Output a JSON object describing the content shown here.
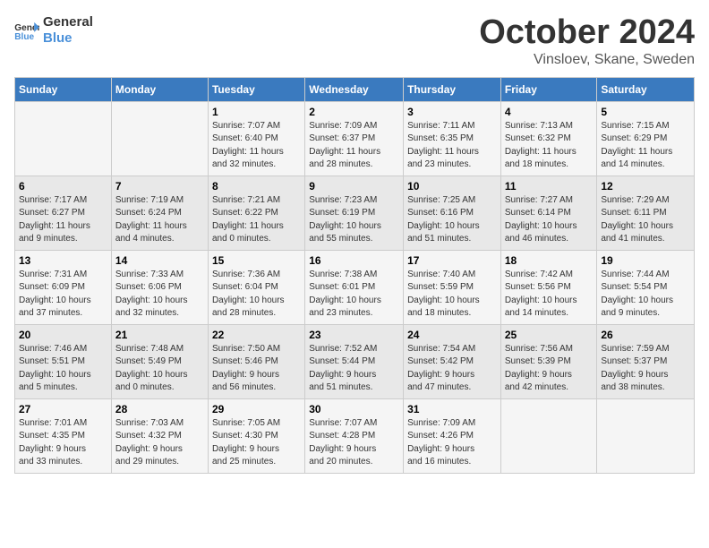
{
  "header": {
    "logo_general": "General",
    "logo_blue": "Blue",
    "month_title": "October 2024",
    "location": "Vinsloev, Skane, Sweden"
  },
  "days_of_week": [
    "Sunday",
    "Monday",
    "Tuesday",
    "Wednesday",
    "Thursday",
    "Friday",
    "Saturday"
  ],
  "weeks": [
    [
      {
        "day": "",
        "info": ""
      },
      {
        "day": "",
        "info": ""
      },
      {
        "day": "1",
        "info": "Sunrise: 7:07 AM\nSunset: 6:40 PM\nDaylight: 11 hours\nand 32 minutes."
      },
      {
        "day": "2",
        "info": "Sunrise: 7:09 AM\nSunset: 6:37 PM\nDaylight: 11 hours\nand 28 minutes."
      },
      {
        "day": "3",
        "info": "Sunrise: 7:11 AM\nSunset: 6:35 PM\nDaylight: 11 hours\nand 23 minutes."
      },
      {
        "day": "4",
        "info": "Sunrise: 7:13 AM\nSunset: 6:32 PM\nDaylight: 11 hours\nand 18 minutes."
      },
      {
        "day": "5",
        "info": "Sunrise: 7:15 AM\nSunset: 6:29 PM\nDaylight: 11 hours\nand 14 minutes."
      }
    ],
    [
      {
        "day": "6",
        "info": "Sunrise: 7:17 AM\nSunset: 6:27 PM\nDaylight: 11 hours\nand 9 minutes."
      },
      {
        "day": "7",
        "info": "Sunrise: 7:19 AM\nSunset: 6:24 PM\nDaylight: 11 hours\nand 4 minutes."
      },
      {
        "day": "8",
        "info": "Sunrise: 7:21 AM\nSunset: 6:22 PM\nDaylight: 11 hours\nand 0 minutes."
      },
      {
        "day": "9",
        "info": "Sunrise: 7:23 AM\nSunset: 6:19 PM\nDaylight: 10 hours\nand 55 minutes."
      },
      {
        "day": "10",
        "info": "Sunrise: 7:25 AM\nSunset: 6:16 PM\nDaylight: 10 hours\nand 51 minutes."
      },
      {
        "day": "11",
        "info": "Sunrise: 7:27 AM\nSunset: 6:14 PM\nDaylight: 10 hours\nand 46 minutes."
      },
      {
        "day": "12",
        "info": "Sunrise: 7:29 AM\nSunset: 6:11 PM\nDaylight: 10 hours\nand 41 minutes."
      }
    ],
    [
      {
        "day": "13",
        "info": "Sunrise: 7:31 AM\nSunset: 6:09 PM\nDaylight: 10 hours\nand 37 minutes."
      },
      {
        "day": "14",
        "info": "Sunrise: 7:33 AM\nSunset: 6:06 PM\nDaylight: 10 hours\nand 32 minutes."
      },
      {
        "day": "15",
        "info": "Sunrise: 7:36 AM\nSunset: 6:04 PM\nDaylight: 10 hours\nand 28 minutes."
      },
      {
        "day": "16",
        "info": "Sunrise: 7:38 AM\nSunset: 6:01 PM\nDaylight: 10 hours\nand 23 minutes."
      },
      {
        "day": "17",
        "info": "Sunrise: 7:40 AM\nSunset: 5:59 PM\nDaylight: 10 hours\nand 18 minutes."
      },
      {
        "day": "18",
        "info": "Sunrise: 7:42 AM\nSunset: 5:56 PM\nDaylight: 10 hours\nand 14 minutes."
      },
      {
        "day": "19",
        "info": "Sunrise: 7:44 AM\nSunset: 5:54 PM\nDaylight: 10 hours\nand 9 minutes."
      }
    ],
    [
      {
        "day": "20",
        "info": "Sunrise: 7:46 AM\nSunset: 5:51 PM\nDaylight: 10 hours\nand 5 minutes."
      },
      {
        "day": "21",
        "info": "Sunrise: 7:48 AM\nSunset: 5:49 PM\nDaylight: 10 hours\nand 0 minutes."
      },
      {
        "day": "22",
        "info": "Sunrise: 7:50 AM\nSunset: 5:46 PM\nDaylight: 9 hours\nand 56 minutes."
      },
      {
        "day": "23",
        "info": "Sunrise: 7:52 AM\nSunset: 5:44 PM\nDaylight: 9 hours\nand 51 minutes."
      },
      {
        "day": "24",
        "info": "Sunrise: 7:54 AM\nSunset: 5:42 PM\nDaylight: 9 hours\nand 47 minutes."
      },
      {
        "day": "25",
        "info": "Sunrise: 7:56 AM\nSunset: 5:39 PM\nDaylight: 9 hours\nand 42 minutes."
      },
      {
        "day": "26",
        "info": "Sunrise: 7:59 AM\nSunset: 5:37 PM\nDaylight: 9 hours\nand 38 minutes."
      }
    ],
    [
      {
        "day": "27",
        "info": "Sunrise: 7:01 AM\nSunset: 4:35 PM\nDaylight: 9 hours\nand 33 minutes."
      },
      {
        "day": "28",
        "info": "Sunrise: 7:03 AM\nSunset: 4:32 PM\nDaylight: 9 hours\nand 29 minutes."
      },
      {
        "day": "29",
        "info": "Sunrise: 7:05 AM\nSunset: 4:30 PM\nDaylight: 9 hours\nand 25 minutes."
      },
      {
        "day": "30",
        "info": "Sunrise: 7:07 AM\nSunset: 4:28 PM\nDaylight: 9 hours\nand 20 minutes."
      },
      {
        "day": "31",
        "info": "Sunrise: 7:09 AM\nSunset: 4:26 PM\nDaylight: 9 hours\nand 16 minutes."
      },
      {
        "day": "",
        "info": ""
      },
      {
        "day": "",
        "info": ""
      }
    ]
  ]
}
